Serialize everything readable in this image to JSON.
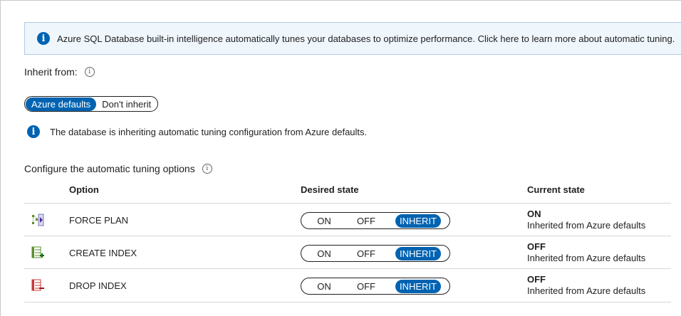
{
  "banner": {
    "icon": "info-icon",
    "text": "Azure SQL Database built-in intelligence automatically tunes your databases to optimize performance. Click here to learn more about automatic tuning."
  },
  "inherit": {
    "label": "Inherit from:",
    "options": [
      "Azure defaults",
      "Don't inherit"
    ],
    "selected": "Azure defaults"
  },
  "notice": "The database is inheriting automatic tuning configuration from Azure defaults.",
  "section_label": "Configure the automatic tuning options",
  "table": {
    "headers": {
      "option": "Option",
      "desired": "Desired state",
      "current": "Current state"
    },
    "toggle_labels": {
      "on": "ON",
      "off": "OFF",
      "inherit": "INHERIT"
    },
    "rows": [
      {
        "icon": "force-plan-icon",
        "name": "FORCE PLAN",
        "desired": "INHERIT",
        "current": "ON",
        "current_note": "Inherited from Azure defaults"
      },
      {
        "icon": "create-index-icon",
        "name": "CREATE INDEX",
        "desired": "INHERIT",
        "current": "OFF",
        "current_note": "Inherited from Azure defaults"
      },
      {
        "icon": "drop-index-icon",
        "name": "DROP INDEX",
        "desired": "INHERIT",
        "current": "OFF",
        "current_note": "Inherited from Azure defaults"
      }
    ]
  },
  "colors": {
    "accent": "#0063b1",
    "banner_bg": "#eff6fc"
  }
}
